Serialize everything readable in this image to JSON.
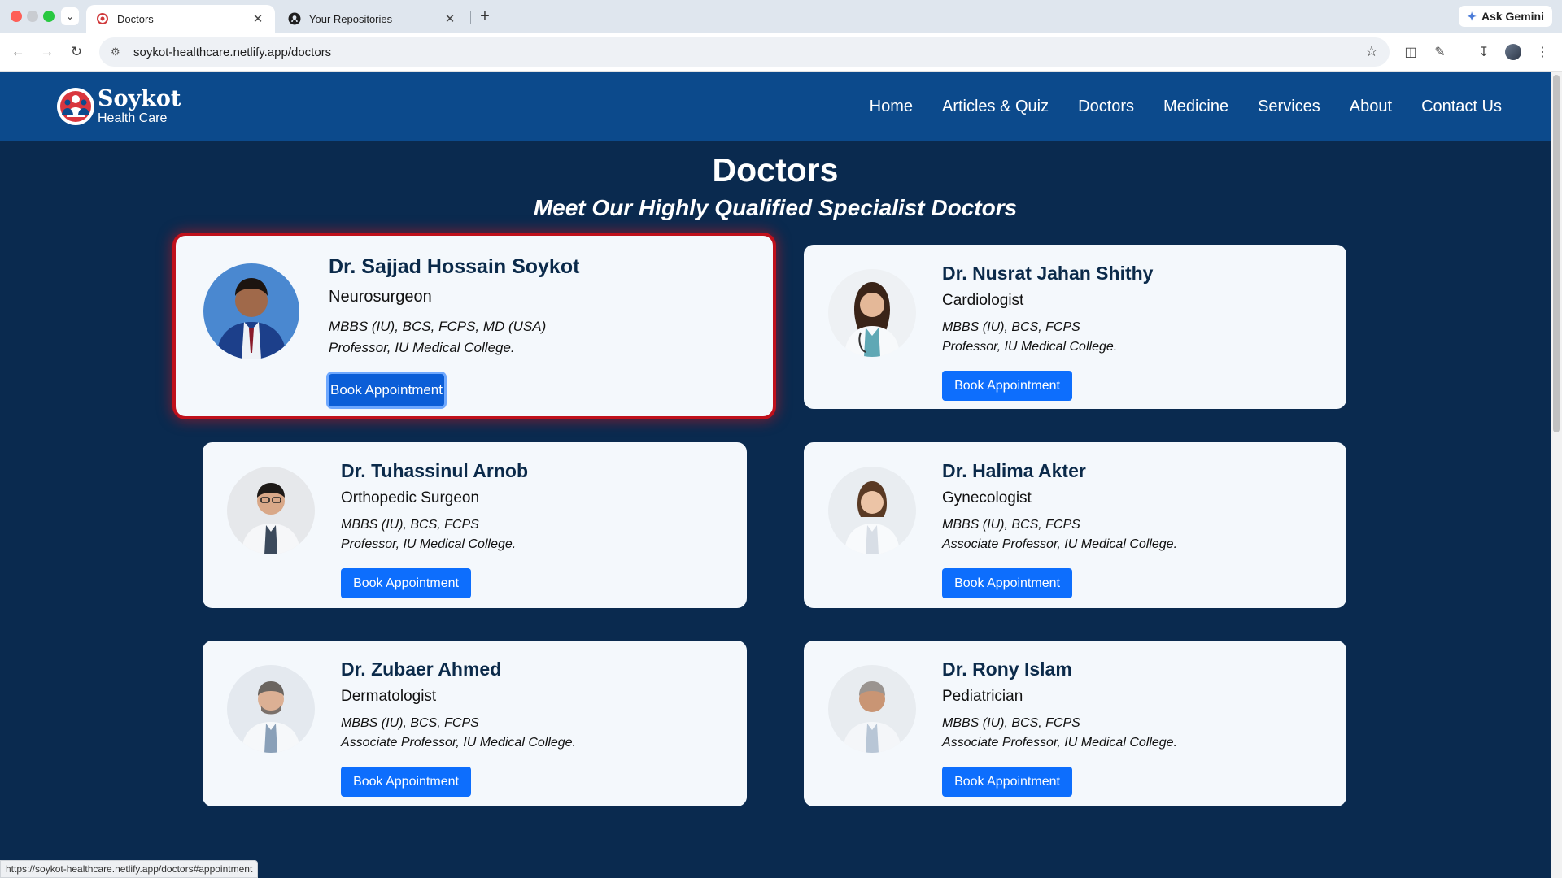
{
  "browser": {
    "tabs": [
      {
        "title": "Doctors",
        "active": true,
        "icon": "site-favicon"
      },
      {
        "title": "Your Repositories",
        "active": false,
        "icon": "github-icon"
      }
    ],
    "url": "soykot-healthcare.netlify.app/doctors",
    "ask_gemini": "Ask Gemini",
    "status_url": "https://soykot-healthcare.netlify.app/doctors#appointment"
  },
  "site": {
    "brand": "Soykot",
    "brand_sub": "Health Care",
    "nav": [
      "Home",
      "Articles & Quiz",
      "Doctors",
      "Medicine",
      "Services",
      "About",
      "Contact Us"
    ]
  },
  "main": {
    "title": "Doctors",
    "subtitle": "Meet Our Highly Qualified Specialist Doctors"
  },
  "doctors": [
    {
      "name": "Dr. Sajjad Hossain Soykot",
      "specialty": "Neurosurgeon",
      "qualification": "MBBS (IU), BCS, FCPS, MD (USA)",
      "position": "Professor, IU Medical College.",
      "button": "Book Appointment",
      "highlighted": true
    },
    {
      "name": "Dr. Nusrat Jahan Shithy",
      "specialty": "Cardiologist",
      "qualification": "MBBS (IU), BCS, FCPS",
      "position": "Professor, IU Medical College.",
      "button": "Book Appointment"
    },
    {
      "name": "Dr. Tuhassinul Arnob",
      "specialty": "Orthopedic Surgeon",
      "qualification": "MBBS (IU), BCS, FCPS",
      "position": "Professor, IU Medical College.",
      "button": "Book Appointment"
    },
    {
      "name": "Dr. Halima Akter",
      "specialty": "Gynecologist",
      "qualification": "MBBS (IU), BCS, FCPS",
      "position": "Associate Professor, IU Medical College.",
      "button": "Book Appointment"
    },
    {
      "name": "Dr. Zubaer Ahmed",
      "specialty": "Dermatologist",
      "qualification": "MBBS (IU), BCS, FCPS",
      "position": "Associate Professor, IU Medical College.",
      "button": "Book Appointment"
    },
    {
      "name": "Dr. Rony Islam",
      "specialty": "Pediatrician",
      "qualification": "MBBS (IU), BCS, FCPS",
      "position": "Associate Professor, IU Medical College.",
      "button": "Book Appointment"
    }
  ],
  "colors": {
    "header": "#0c4a8c",
    "page_bg": "#0a2a4f",
    "card_bg": "#f4f8fc",
    "button": "#0d6efd",
    "highlight_border": "#c0101b"
  }
}
